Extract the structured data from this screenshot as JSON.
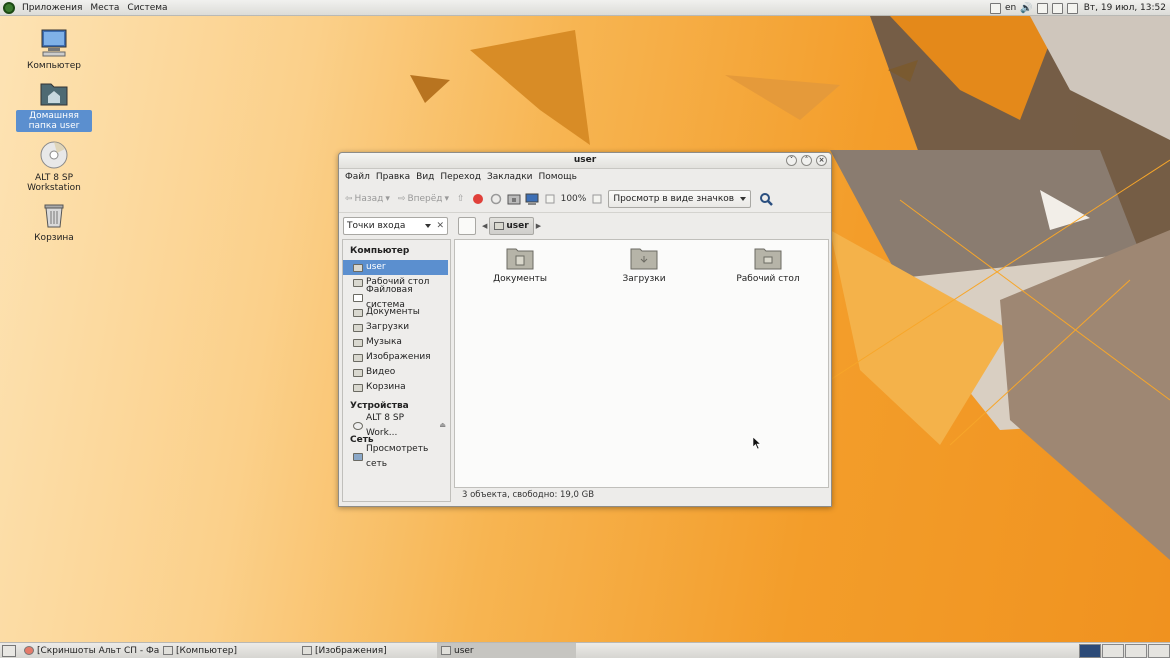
{
  "top_panel": {
    "menus": [
      "Приложения",
      "Места",
      "Система"
    ],
    "keyboard_layout": "en",
    "clock": "Вт, 19 июл, 13:52"
  },
  "desktop": {
    "icons": [
      {
        "label": "Компьютер",
        "icon": "computer-icon"
      },
      {
        "label": "Домашняя папка user",
        "icon": "home-folder-icon",
        "selected": true
      },
      {
        "label": "ALT 8 SP Workstation",
        "icon": "cdrom-icon"
      },
      {
        "label": "Корзина",
        "icon": "trash-icon"
      }
    ]
  },
  "window": {
    "title": "user",
    "menubar": [
      "Файл",
      "Правка",
      "Вид",
      "Переход",
      "Закладки",
      "Помощь"
    ],
    "toolbar": {
      "back_label": "Назад",
      "forward_label": "Вперёд",
      "zoom": "100%",
      "view_mode": "Просмотр в виде значков"
    },
    "places_select": "Точки входа",
    "path": [
      "user"
    ],
    "sidebar": {
      "computer_heading": "Компьютер",
      "computer_items": [
        "user",
        "Рабочий стол",
        "Файловая система",
        "Документы",
        "Загрузки",
        "Музыка",
        "Изображения",
        "Видео",
        "Корзина"
      ],
      "devices_heading": "Устройства",
      "device_items": [
        "ALT 8 SP Work..."
      ],
      "network_heading": "Сеть",
      "network_items": [
        "Просмотреть сеть"
      ]
    },
    "files": [
      "Документы",
      "Загрузки",
      "Рабочий стол"
    ],
    "status": "3 объекта, свободно: 19,0 GB"
  },
  "taskbar": {
    "tasks": [
      "[Скриншоты Альт СП - Фа...",
      "[Компьютер]",
      "[Изображения]",
      "user"
    ]
  },
  "colors": {
    "selection": "#5b8fcf",
    "wallpaper_orange": "#f39d2a",
    "wallpaper_light": "#fde3b4"
  }
}
